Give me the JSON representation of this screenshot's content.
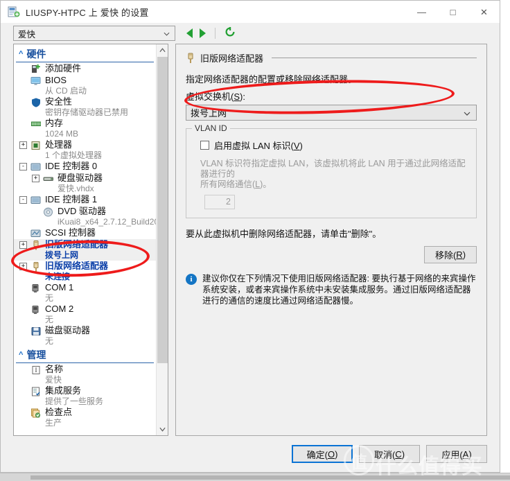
{
  "window": {
    "title": "LIUSPY-HTPC 上 爱快 的设置",
    "icon": "hyperv-settings-icon",
    "minimize_label": "—",
    "maximize_label": "□",
    "close_label": "✕"
  },
  "toolbar": {
    "vm_select_value": "爱快",
    "back_icon": "triangle-left-icon",
    "forward_icon": "triangle-right-icon",
    "refresh_icon": "refresh-icon"
  },
  "tree": {
    "sections": [
      {
        "label": "硬件",
        "collapse_icon": "chevron-up-icon",
        "items": [
          {
            "label": "添加硬件",
            "sub": "",
            "icon": "add-hardware-icon",
            "expander": "",
            "highlight": false
          },
          {
            "label": "BIOS",
            "sub": "从 CD 启动",
            "icon": "bios-monitor-icon",
            "expander": "",
            "highlight": false
          },
          {
            "label": "安全性",
            "sub": "密钥存储驱动器已禁用",
            "icon": "shield-icon",
            "expander": "",
            "highlight": false
          },
          {
            "label": "内存",
            "sub": "1024 MB",
            "icon": "memory-icon",
            "expander": "",
            "highlight": false
          },
          {
            "label": "处理器",
            "sub": "1 个虚拟处理器",
            "icon": "cpu-icon",
            "expander": "+",
            "highlight": false
          },
          {
            "label": "IDE 控制器 0",
            "sub": "",
            "icon": "ide-controller-icon",
            "expander": "-",
            "highlight": false
          },
          {
            "label": "硬盘驱动器",
            "sub": "爱快.vhdx",
            "icon": "hard-drive-icon",
            "expander": "+",
            "indent": 1,
            "highlight": false
          },
          {
            "label": "IDE 控制器 1",
            "sub": "",
            "icon": "ide-controller-icon",
            "expander": "-",
            "highlight": false
          },
          {
            "label": "DVD 驱动器",
            "sub": "iKuai8_x64_2.7.12_Build20...",
            "icon": "dvd-drive-icon",
            "indent": 1,
            "expander": "",
            "highlight": false
          },
          {
            "label": "SCSI 控制器",
            "sub": "",
            "icon": "scsi-controller-icon",
            "expander": "",
            "highlight": false
          },
          {
            "label": "旧版网络适配器",
            "sub": "拨号上网",
            "icon": "legacy-network-adapter-icon",
            "expander": "+",
            "highlight": true,
            "selected": true
          },
          {
            "label": "旧版网络适配器",
            "sub": "未连接",
            "icon": "legacy-network-adapter-icon",
            "expander": "+",
            "highlight": true
          },
          {
            "label": "COM 1",
            "sub": "无",
            "icon": "com-port-icon",
            "expander": "",
            "highlight": false
          },
          {
            "label": "COM 2",
            "sub": "无",
            "icon": "com-port-icon",
            "expander": "",
            "highlight": false
          },
          {
            "label": "磁盘驱动器",
            "sub": "无",
            "icon": "floppy-drive-icon",
            "expander": "",
            "highlight": false
          }
        ]
      },
      {
        "label": "管理",
        "collapse_icon": "chevron-up-icon",
        "items": [
          {
            "label": "名称",
            "sub": "爱快",
            "icon": "name-icon",
            "expander": "",
            "highlight": false
          },
          {
            "label": "集成服务",
            "sub": "提供了一些服务",
            "icon": "integration-services-icon",
            "expander": "",
            "highlight": false
          },
          {
            "label": "检查点",
            "sub": "生产",
            "icon": "checkpoint-icon",
            "expander": "",
            "highlight": false
          }
        ]
      }
    ],
    "scrollbar": {
      "up_arrow": "▲",
      "down_arrow": "▼"
    }
  },
  "panel": {
    "header_title": "旧版网络适配器",
    "header_icon": "legacy-network-adapter-icon",
    "description": "指定网络适配器的配置或移除网络适配器。",
    "switch_label_pre": "虚拟交换机(",
    "switch_label_key": "S",
    "switch_label_post": "):",
    "switch_value": "拨号上网",
    "vlan_group_legend": "VLAN ID",
    "vlan_checkbox_pre": "启用虚拟 LAN 标识(",
    "vlan_checkbox_key": "V",
    "vlan_checkbox_post": ")",
    "vlan_checked": false,
    "vlan_help_line1": "VLAN 标识符指定虚拟 LAN，该虚拟机将此 LAN 用于通过此网络适配器进行的",
    "vlan_help_line2_pre": "所有网络通信(",
    "vlan_help_line2_key": "L",
    "vlan_help_line2_post": ")。",
    "vlan_id_value": "2",
    "remove_text": "要从此虚拟机中删除网络适配器，请单击\"删除\"。",
    "remove_button_pre": "移除(",
    "remove_button_key": "R",
    "remove_button_post": ")",
    "info_icon": "info-icon",
    "info_text": "建议你仅在下列情况下使用旧版网络适配器: 要执行基于网络的来宾操作系统安装，或者来宾操作系统中未安装集成服务。通过旧版网络适配器进行的通信的速度比通过网络适配器慢。"
  },
  "footer": {
    "ok_pre": "确定(",
    "ok_key": "O",
    "ok_post": ")",
    "cancel_pre": "取消(",
    "cancel_key": "C",
    "cancel_post": ")",
    "apply_pre": "应用(",
    "apply_key": "A",
    "apply_post": ")"
  },
  "watermark": {
    "mark": "值",
    "text": "什么值得买"
  },
  "colors": {
    "accent_blue": "#0a73d4",
    "link_blue": "#0b3fa8",
    "section_blue": "#19509e",
    "annotation_red": "#ee1b1b",
    "green": "#22a033",
    "info_blue": "#1475c4"
  }
}
